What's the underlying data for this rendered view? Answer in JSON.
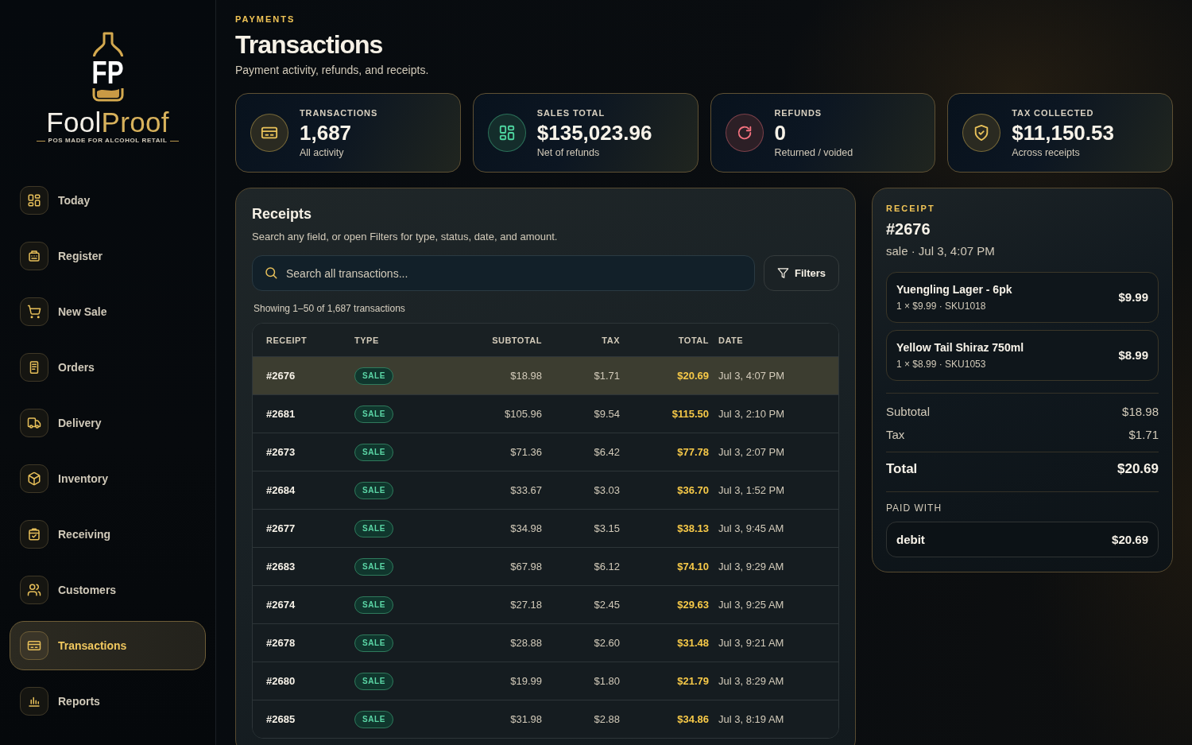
{
  "sidebar": {
    "logo": {
      "monogram": "FP",
      "name_start": "Fool",
      "name_end": "Proof",
      "tagline": "POS MADE FOR ALCOHOL RETAIL"
    },
    "items": [
      {
        "label": "Today",
        "selected": false
      },
      {
        "label": "Register",
        "selected": false
      },
      {
        "label": "New Sale",
        "selected": false
      },
      {
        "label": "Orders",
        "selected": false
      },
      {
        "label": "Delivery",
        "selected": false
      },
      {
        "label": "Inventory",
        "selected": false
      },
      {
        "label": "Receiving",
        "selected": false
      },
      {
        "label": "Customers",
        "selected": false
      },
      {
        "label": "Transactions",
        "selected": true
      },
      {
        "label": "Reports",
        "selected": false
      }
    ]
  },
  "header": {
    "eyebrow": "PAYMENTS",
    "title": "Transactions",
    "subtitle": "Payment activity, refunds, and receipts."
  },
  "stats": [
    {
      "label": "TRANSACTIONS",
      "value": "1,687",
      "note": "All activity",
      "color": "#e9c25a"
    },
    {
      "label": "SALES TOTAL",
      "value": "$135,023.96",
      "note": "Net of refunds",
      "color": "#4ed6a0"
    },
    {
      "label": "REFUNDS",
      "value": "0",
      "note": "Returned / voided",
      "color": "#f4727f"
    },
    {
      "label": "TAX COLLECTED",
      "value": "$11,150.53",
      "note": "Across receipts",
      "color": "#e9c25a"
    }
  ],
  "receipts": {
    "title": "Receipts",
    "subtitle": "Search any field, or open Filters for type, status, date, and amount.",
    "search": {
      "placeholder": "Search all transactions..."
    },
    "filters_button": "Filters",
    "count_text": "Showing 1–50 of 1,687 transactions",
    "table": {
      "columns": [
        "RECEIPT",
        "TYPE",
        "SUBTOTAL",
        "TAX",
        "TOTAL",
        "DATE"
      ],
      "rows": [
        {
          "receipt": "#2676",
          "type": "SALE",
          "subtotal": "$18.98",
          "tax": "$1.71",
          "total": "$20.69",
          "date": "Jul 3, 4:07 PM",
          "selected": true
        },
        {
          "receipt": "#2681",
          "type": "SALE",
          "subtotal": "$105.96",
          "tax": "$9.54",
          "total": "$115.50",
          "date": "Jul 3, 2:10 PM",
          "selected": false
        },
        {
          "receipt": "#2673",
          "type": "SALE",
          "subtotal": "$71.36",
          "tax": "$6.42",
          "total": "$77.78",
          "date": "Jul 3, 2:07 PM",
          "selected": false
        },
        {
          "receipt": "#2684",
          "type": "SALE",
          "subtotal": "$33.67",
          "tax": "$3.03",
          "total": "$36.70",
          "date": "Jul 3, 1:52 PM",
          "selected": false
        },
        {
          "receipt": "#2677",
          "type": "SALE",
          "subtotal": "$34.98",
          "tax": "$3.15",
          "total": "$38.13",
          "date": "Jul 3, 9:45 AM",
          "selected": false
        },
        {
          "receipt": "#2683",
          "type": "SALE",
          "subtotal": "$67.98",
          "tax": "$6.12",
          "total": "$74.10",
          "date": "Jul 3, 9:29 AM",
          "selected": false
        },
        {
          "receipt": "#2674",
          "type": "SALE",
          "subtotal": "$27.18",
          "tax": "$2.45",
          "total": "$29.63",
          "date": "Jul 3, 9:25 AM",
          "selected": false
        },
        {
          "receipt": "#2678",
          "type": "SALE",
          "subtotal": "$28.88",
          "tax": "$2.60",
          "total": "$31.48",
          "date": "Jul 3, 9:21 AM",
          "selected": false
        },
        {
          "receipt": "#2680",
          "type": "SALE",
          "subtotal": "$19.99",
          "tax": "$1.80",
          "total": "$21.79",
          "date": "Jul 3, 8:29 AM",
          "selected": false
        },
        {
          "receipt": "#2685",
          "type": "SALE",
          "subtotal": "$31.98",
          "tax": "$2.88",
          "total": "$34.86",
          "date": "Jul 3, 8:19 AM",
          "selected": false
        }
      ]
    }
  },
  "receipt_detail": {
    "eyebrow": "RECEIPT",
    "number": "#2676",
    "meta": "sale · Jul 3, 4:07 PM",
    "items": [
      {
        "name": "Yuengling Lager - 6pk",
        "detail": "1 × $9.99 · SKU1018",
        "price": "$9.99"
      },
      {
        "name": "Yellow Tail Shiraz 750ml",
        "detail": "1 × $8.99 · SKU1053",
        "price": "$8.99"
      }
    ],
    "summary": [
      {
        "label": "Subtotal",
        "value": "$18.98"
      },
      {
        "label": "Tax",
        "value": "$1.71"
      }
    ],
    "total": {
      "label": "Total",
      "value": "$20.69"
    },
    "paid_with": {
      "label": "PAID WITH",
      "method": "debit",
      "amount": "$20.69"
    }
  }
}
